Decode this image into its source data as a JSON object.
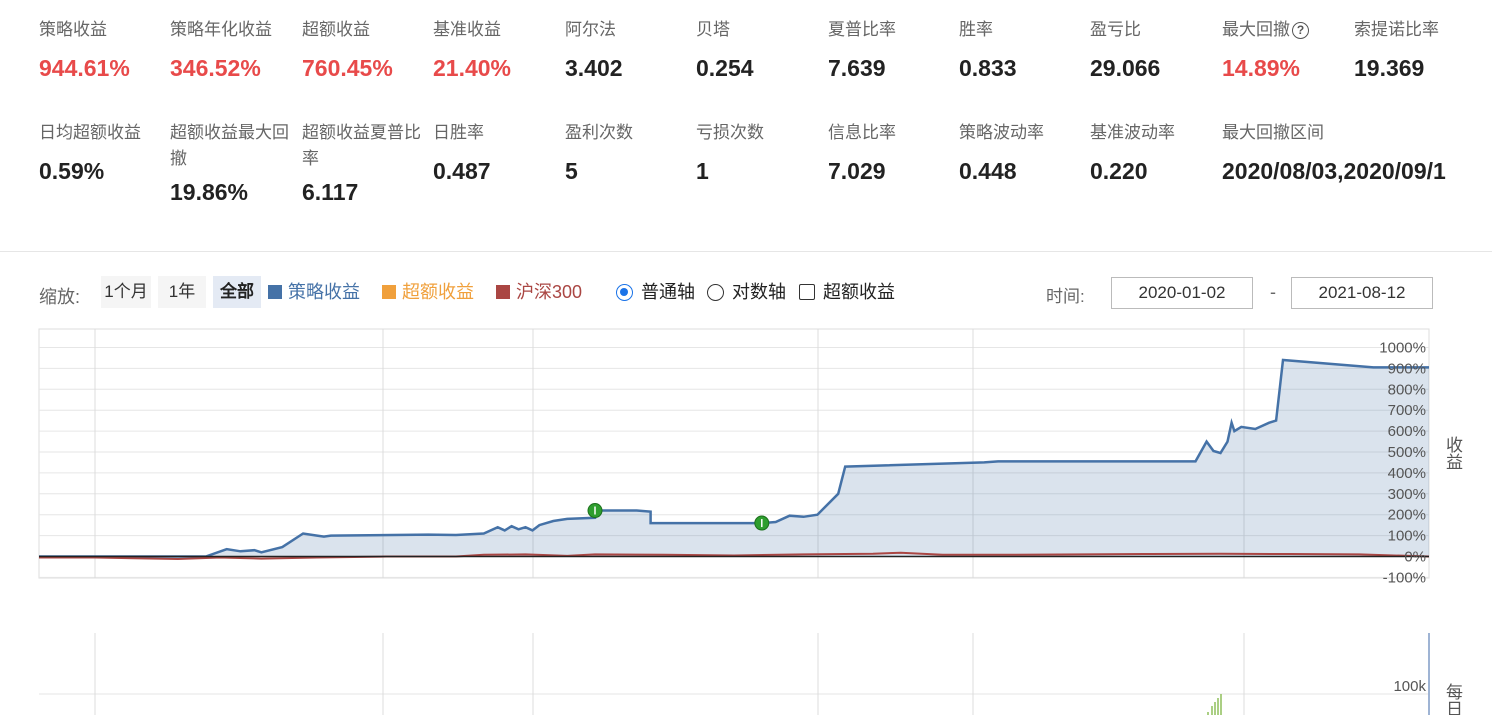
{
  "stats_row1": [
    {
      "label": "策略收益",
      "value": "944.61%",
      "red": true
    },
    {
      "label": "策略年化收益",
      "value": "346.52%",
      "red": true
    },
    {
      "label": "超额收益",
      "value": "760.45%",
      "red": true
    },
    {
      "label": "基准收益",
      "value": "21.40%",
      "red": true
    },
    {
      "label": "阿尔法",
      "value": "3.402",
      "red": false
    },
    {
      "label": "贝塔",
      "value": "0.254",
      "red": false
    },
    {
      "label": "夏普比率",
      "value": "7.639",
      "red": false
    },
    {
      "label": "胜率",
      "value": "0.833",
      "red": false
    },
    {
      "label": "盈亏比",
      "value": "29.066",
      "red": false
    },
    {
      "label": "最大回撤",
      "value": "14.89%",
      "red": true,
      "help": "?"
    },
    {
      "label": "索提诺比率",
      "value": "19.369",
      "red": false
    }
  ],
  "stats_row2": [
    {
      "label": "日均超额收益",
      "value": "0.59%"
    },
    {
      "label": "超额收益最大回撤",
      "value": "19.86%"
    },
    {
      "label": "超额收益夏普比率",
      "value": "6.117"
    },
    {
      "label": "日胜率",
      "value": "0.487"
    },
    {
      "label": "盈利次数",
      "value": "5"
    },
    {
      "label": "亏损次数",
      "value": "1"
    },
    {
      "label": "信息比率",
      "value": "7.029"
    },
    {
      "label": "策略波动率",
      "value": "0.448"
    },
    {
      "label": "基准波动率",
      "value": "0.220"
    },
    {
      "label": "最大回撤区间",
      "value": "2020/08/03,2020/09/1"
    }
  ],
  "toolbar": {
    "zoom_label": "缩放:",
    "zoom_buttons": [
      "1个月",
      "1年",
      "全部"
    ],
    "active_zoom": "全部",
    "legend": [
      {
        "label": "策略收益",
        "color": "#4572a7"
      },
      {
        "label": "超额收益",
        "color": "#f0a03c"
      },
      {
        "label": "沪深300",
        "color": "#aa4643"
      }
    ],
    "axis_normal": "普通轴",
    "axis_log": "对数轴",
    "excess_checkbox": "超额收益",
    "time_label": "时间:",
    "date_from": "2020-01-02",
    "date_sep": "-",
    "date_to": "2021-08-12"
  },
  "chart_data": [
    {
      "type": "area",
      "y_axis_title": "收益",
      "yticks": [
        "1000%",
        "900%",
        "800%",
        "700%",
        "600%",
        "500%",
        "400%",
        "300%",
        "200%",
        "100%",
        "0%",
        "-100%"
      ],
      "ylim": [
        -100,
        1000
      ],
      "xlim": [
        0,
        1
      ],
      "series": [
        {
          "name": "策略收益",
          "color": "#4572a7",
          "x": [
            0,
            0.12,
            0.135,
            0.145,
            0.155,
            0.16,
            0.175,
            0.19,
            0.2,
            0.205,
            0.21,
            0.28,
            0.3,
            0.32,
            0.33,
            0.335,
            0.34,
            0.345,
            0.35,
            0.355,
            0.36,
            0.37,
            0.38,
            0.4,
            0.4,
            0.43,
            0.44,
            0.44,
            0.52,
            0.53,
            0.54,
            0.55,
            0.56,
            0.575,
            0.58,
            0.68,
            0.69,
            0.7,
            0.705,
            0.71,
            0.715,
            0.72,
            0.73,
            0.74,
            0.75,
            0.76,
            0.83,
            0.832,
            0.84,
            0.845,
            0.85,
            0.855,
            0.858,
            0.86,
            0.865,
            0.875,
            0.885,
            0.89,
            0.895,
            0.96,
            1.0
          ],
          "y": [
            0,
            0,
            35,
            25,
            30,
            20,
            45,
            110,
            100,
            95,
            100,
            105,
            103,
            110,
            140,
            125,
            145,
            130,
            140,
            125,
            150,
            170,
            180,
            185,
            220,
            220,
            215,
            160,
            160,
            165,
            195,
            190,
            200,
            300,
            430,
            450,
            455,
            455,
            455,
            455,
            455,
            455,
            455,
            455,
            455,
            455,
            455,
            455,
            550,
            505,
            495,
            550,
            640,
            600,
            620,
            610,
            640,
            650,
            940,
            905,
            905
          ]
        },
        {
          "name": "沪深300",
          "color": "#aa4643",
          "x": [
            0,
            0.04,
            0.1,
            0.13,
            0.16,
            0.2,
            0.25,
            0.3,
            0.32,
            0.35,
            0.38,
            0.4,
            0.45,
            0.5,
            0.55,
            0.6,
            0.62,
            0.65,
            0.7,
            0.75,
            0.8,
            0.85,
            0.9,
            0.95,
            1.0
          ],
          "y": [
            -5,
            -5,
            -12,
            -5,
            -10,
            -5,
            0,
            0,
            8,
            10,
            3,
            10,
            8,
            5,
            10,
            13,
            18,
            8,
            8,
            10,
            12,
            13,
            12,
            10,
            0
          ]
        }
      ],
      "markers": [
        {
          "x": 0.4,
          "y": 220,
          "color": "#2e9e2e"
        },
        {
          "x": 0.52,
          "y": 160,
          "color": "#2e9e2e"
        }
      ]
    },
    {
      "type": "bar",
      "y_axis_title": "每日",
      "yticks": [
        "100k"
      ]
    }
  ]
}
